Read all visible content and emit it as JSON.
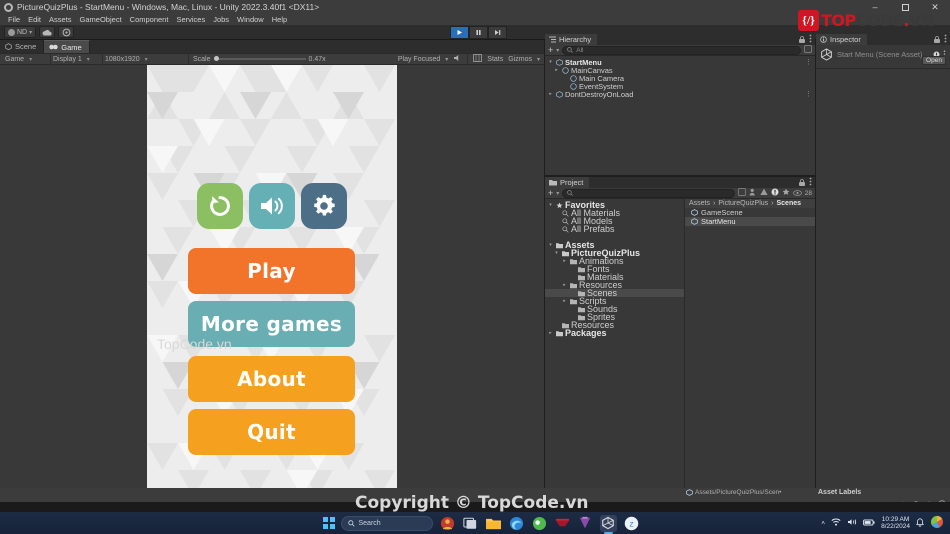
{
  "window": {
    "title": "PictureQuizPlus - StartMenu - Windows, Mac, Linux - Unity 2022.3.40f1 <DX11>",
    "app_icon": "unity-icon",
    "minimize": "–",
    "maximize": "⬜",
    "close": "✕"
  },
  "menu": {
    "items": [
      "File",
      "Edit",
      "Assets",
      "GameObject",
      "Component",
      "Services",
      "Jobs",
      "Window",
      "Help"
    ]
  },
  "toolbar": {
    "account_label": "ND",
    "account_caret": "▾",
    "cloud_icon": "cloud-icon",
    "settings_icon": "gear-icon",
    "play_icon": "play-icon",
    "pause_icon": "pause-icon",
    "step_icon": "step-icon"
  },
  "game_panel": {
    "tabs": [
      {
        "label": "Scene",
        "icon": "scene-icon",
        "active": false
      },
      {
        "label": "Game",
        "icon": "game-icon",
        "active": true
      }
    ],
    "view_mode": "Game",
    "display": "Display 1",
    "resolution": "1080x1920",
    "scale_label": "Scale",
    "scale_value": "0.47x",
    "play_focused": "Play Focused",
    "mute_icon": "mute-audio-icon",
    "frame_icon": "frame-icon",
    "stats": "Stats",
    "gizmos": "Gizmos",
    "caret": "▾"
  },
  "game_screen": {
    "icon_buttons": [
      {
        "name": "restart-icon",
        "color": "#8cbf61"
      },
      {
        "name": "sound-icon",
        "color": "#64b0b5"
      },
      {
        "name": "settings-gear-icon",
        "color": "#4d6e87"
      }
    ],
    "menu_buttons": [
      {
        "label": "Play",
        "color": "#f2732a"
      },
      {
        "label": "More games",
        "color": "#69aeb2"
      },
      {
        "label": "About",
        "color": "#f5a11f"
      },
      {
        "label": "Quit",
        "color": "#f5a11f"
      }
    ],
    "watermark": "TopCode.vn"
  },
  "hierarchy": {
    "tab_label": "Hierarchy",
    "tab_icon": "hierarchy-icon",
    "lock_icon": "lock-icon",
    "menu_icon": "kebab-icon",
    "add_label": "+",
    "search_placeholder": "All",
    "search_value": "",
    "nodes": [
      {
        "label": "StartMenu",
        "indent": 0,
        "arrow": "▾",
        "icon": "scene-icon",
        "bold": true,
        "kebab": true
      },
      {
        "label": "MainCanvas",
        "indent": 1,
        "arrow": "▸",
        "icon": "gameobject-icon",
        "bold": false,
        "kebab": false
      },
      {
        "label": "Main Camera",
        "indent": 2,
        "arrow": "",
        "icon": "gameobject-icon",
        "bold": false,
        "kebab": false
      },
      {
        "label": "EventSystem",
        "indent": 2,
        "arrow": "",
        "icon": "gameobject-icon",
        "bold": false,
        "kebab": false
      },
      {
        "label": "DontDestroyOnLoad",
        "indent": 0,
        "arrow": "▸",
        "icon": "scene-icon",
        "bold": false,
        "kebab": true
      }
    ]
  },
  "project": {
    "tab_label": "Project",
    "tab_icon": "folder-icon",
    "lock_icon": "lock-icon",
    "menu_icon": "kebab-icon",
    "add_label": "+",
    "search_placeholder": "",
    "count_badge": "28",
    "eye_icon": "eye-icon",
    "star_icon": "star-icon",
    "warn_icon": "warning-icon",
    "error_icon": "error-icon",
    "tree": [
      {
        "label": "Favorites",
        "indent": 0,
        "arrow": "▾",
        "icon": "star-icon",
        "bold": true,
        "selected": false
      },
      {
        "label": "All Materials",
        "indent": 1,
        "arrow": "",
        "icon": "search-icon",
        "bold": false,
        "selected": false
      },
      {
        "label": "All Models",
        "indent": 1,
        "arrow": "",
        "icon": "search-icon",
        "bold": false,
        "selected": false
      },
      {
        "label": "All Prefabs",
        "indent": 1,
        "arrow": "",
        "icon": "search-icon",
        "bold": false,
        "selected": false
      },
      {
        "label": "",
        "indent": 0,
        "arrow": "",
        "icon": "",
        "bold": false,
        "selected": false
      },
      {
        "label": "Assets",
        "indent": 0,
        "arrow": "▾",
        "icon": "folder-icon",
        "bold": true,
        "selected": false
      },
      {
        "label": "PictureQuizPlus",
        "indent": 1,
        "arrow": "▾",
        "icon": "folder-icon",
        "bold": true,
        "selected": false
      },
      {
        "label": "Animations",
        "indent": 2,
        "arrow": "▸",
        "icon": "folder-icon",
        "bold": false,
        "selected": false
      },
      {
        "label": "Fonts",
        "indent": 3,
        "arrow": "",
        "icon": "folder-icon",
        "bold": false,
        "selected": false
      },
      {
        "label": "Materials",
        "indent": 3,
        "arrow": "",
        "icon": "folder-icon",
        "bold": false,
        "selected": false
      },
      {
        "label": "Resources",
        "indent": 2,
        "arrow": "▸",
        "icon": "folder-icon",
        "bold": false,
        "selected": false
      },
      {
        "label": "Scenes",
        "indent": 3,
        "arrow": "",
        "icon": "folder-icon",
        "bold": false,
        "selected": true
      },
      {
        "label": "Scripts",
        "indent": 2,
        "arrow": "▸",
        "icon": "folder-icon",
        "bold": false,
        "selected": false
      },
      {
        "label": "Sounds",
        "indent": 3,
        "arrow": "",
        "icon": "folder-icon",
        "bold": false,
        "selected": false
      },
      {
        "label": "Sprites",
        "indent": 3,
        "arrow": "",
        "icon": "folder-icon",
        "bold": false,
        "selected": false
      },
      {
        "label": "Resources",
        "indent": 1,
        "arrow": "",
        "icon": "folder-icon",
        "bold": false,
        "selected": false
      },
      {
        "label": "Packages",
        "indent": 0,
        "arrow": "▸",
        "icon": "folder-icon",
        "bold": true,
        "selected": false
      }
    ],
    "breadcrumbs": [
      "Assets",
      "PictureQuizPlus",
      "Scenes"
    ],
    "breadcrumb_sep": "›",
    "assets": [
      {
        "label": "GameScene",
        "icon": "scene-asset-icon",
        "selected": false
      },
      {
        "label": "StartMenu",
        "icon": "scene-asset-icon",
        "selected": true
      }
    ]
  },
  "inspector": {
    "tab_label": "Inspector",
    "tab_icon": "inspector-icon",
    "lock_icon": "lock-icon",
    "menu_icon": "kebab-icon",
    "asset_title": "Start Menu (Scene Asset)",
    "asset_icon": "unity-logo-icon",
    "help_icon": "help-icon",
    "kebab_icon": "kebab-icon",
    "open_button": "Open"
  },
  "statusbar": {
    "path": "Assets/PictureQuizPlus/Scen•",
    "path_icon": "scene-asset-icon",
    "asset_labels": "Asset Labels",
    "icons": [
      "bug-icon",
      "layers-icon",
      "cloud-status-icon",
      "notification-icon"
    ]
  },
  "taskbar": {
    "start_icon": "windows-logo-icon",
    "search_placeholder": "Search",
    "search_icon": "search-icon",
    "apps": [
      {
        "name": "app-icon-red",
        "color": "#c23b2e",
        "active": false
      },
      {
        "name": "task-view-icon",
        "color": "#cfd6e0",
        "active": false
      },
      {
        "name": "file-explorer-icon",
        "color": "#ffc848",
        "active": false
      },
      {
        "name": "edge-icon",
        "color": "#2e88d8",
        "active": false
      },
      {
        "name": "app-icon-green",
        "color": "#4fb84f",
        "active": false
      },
      {
        "name": "app-icon-darkred",
        "color": "#a0182a",
        "active": false
      },
      {
        "name": "app-icon-purple",
        "color": "#8b4aa8",
        "active": false
      },
      {
        "name": "unity-taskbar-icon",
        "color": "#d8d8d8",
        "active": true
      },
      {
        "name": "zalo-icon",
        "color": "#eaf2fb",
        "active": false
      }
    ],
    "tray": {
      "chevron": "˄",
      "wifi_icon": "wifi-icon",
      "volume_icon": "volume-icon",
      "battery_icon": "battery-icon",
      "time": "10:29 AM",
      "date": "8/22/2024",
      "bell_icon": "bell-icon",
      "widget_icon": "widget-icon"
    }
  },
  "watermarks": {
    "logo_badge": "{/}",
    "logo_top": "TOP",
    "logo_code": "CODE",
    "logo_dot": ".",
    "logo_vn": "VN",
    "bottom_text": "Copyright © TopCode.vn"
  }
}
